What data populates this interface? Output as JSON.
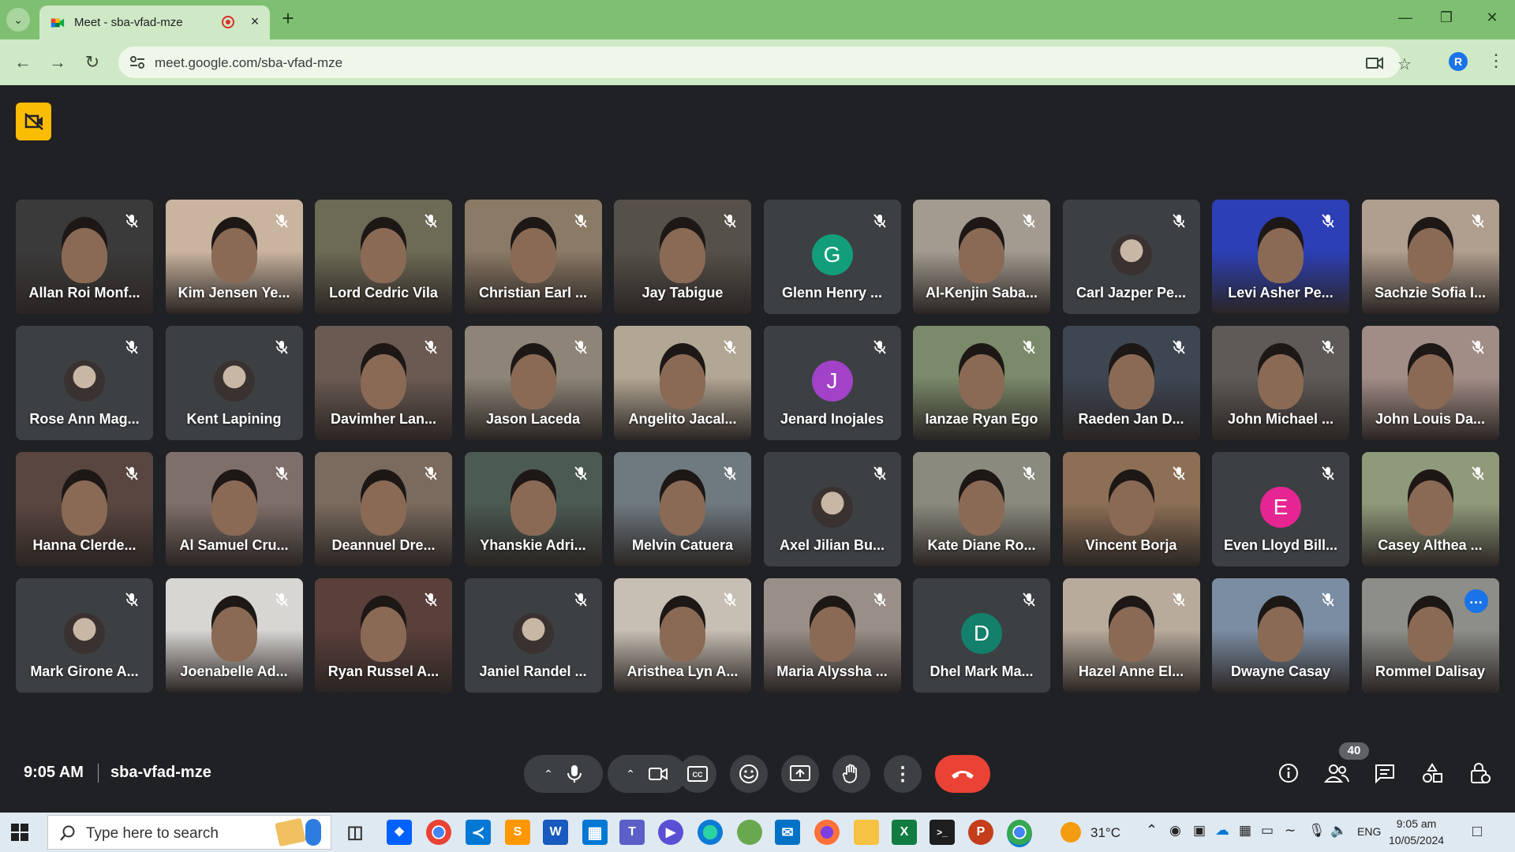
{
  "browser": {
    "tab_title": "Meet - sba-vfad-mze",
    "url": "meet.google.com/sba-vfad-mze",
    "profile_initial": "R",
    "frame_color": "#7fbf72"
  },
  "participants": [
    {
      "name": "Allan Roi Monf...",
      "type": "video",
      "tone": "#3b3a3a"
    },
    {
      "name": "Kim Jensen Ye...",
      "type": "video",
      "tone": "#c9b49f"
    },
    {
      "name": "Lord Cedric Vila",
      "type": "video",
      "tone": "#6d6a55"
    },
    {
      "name": "Christian Earl ...",
      "type": "video",
      "tone": "#8b7a66"
    },
    {
      "name": "Jay Tabigue",
      "type": "video",
      "tone": "#56504a"
    },
    {
      "name": "Glenn Henry ...",
      "type": "initial",
      "initial": "G",
      "color": "#129e7b"
    },
    {
      "name": "Al-Kenjin Saba...",
      "type": "video",
      "tone": "#a39b90"
    },
    {
      "name": "Carl Jazper Pe...",
      "type": "photo"
    },
    {
      "name": "Levi Asher Pe...",
      "type": "video",
      "tone": "#2c3fb5"
    },
    {
      "name": "Sachzie Sofia I...",
      "type": "video",
      "tone": "#b09e8e"
    },
    {
      "name": "Rose Ann Mag...",
      "type": "photo"
    },
    {
      "name": "Kent Lapining",
      "type": "photo"
    },
    {
      "name": "Davimher Lan...",
      "type": "video",
      "tone": "#6a5a52"
    },
    {
      "name": "Jason Laceda",
      "type": "video",
      "tone": "#8e8578"
    },
    {
      "name": "Angelito Jacal...",
      "type": "video",
      "tone": "#b2a694"
    },
    {
      "name": "Jenard Inojales",
      "type": "initial",
      "initial": "J",
      "color": "#a142c8"
    },
    {
      "name": "Ianzae Ryan Ego",
      "type": "video",
      "tone": "#7a8a6a"
    },
    {
      "name": "Raeden Jan D...",
      "type": "video",
      "tone": "#3e4652"
    },
    {
      "name": "John Michael ...",
      "type": "video",
      "tone": "#5e5a57"
    },
    {
      "name": "John Louis Da...",
      "type": "video",
      "tone": "#a28d86"
    },
    {
      "name": "Hanna Clerde...",
      "type": "video",
      "tone": "#5a4640"
    },
    {
      "name": "Al Samuel Cru...",
      "type": "video",
      "tone": "#7f6f6a"
    },
    {
      "name": "Deannuel Dre...",
      "type": "video",
      "tone": "#7a6b5e"
    },
    {
      "name": "Yhanskie Adri...",
      "type": "video",
      "tone": "#4b5a52"
    },
    {
      "name": "Melvin Catuera",
      "type": "video",
      "tone": "#6f7a80"
    },
    {
      "name": "Axel Jilian Bu...",
      "type": "photo"
    },
    {
      "name": "Kate Diane Ro...",
      "type": "video",
      "tone": "#8a8a7e"
    },
    {
      "name": "Vincent Borja",
      "type": "video",
      "tone": "#8c6f55"
    },
    {
      "name": "Even Lloyd Bill...",
      "type": "initial",
      "initial": "E",
      "color": "#e52592"
    },
    {
      "name": "Casey Althea ...",
      "type": "video",
      "tone": "#8f9a7a"
    },
    {
      "name": "Mark Girone A...",
      "type": "photo"
    },
    {
      "name": "Joenabelle Ad...",
      "type": "video",
      "tone": "#d8d6d3"
    },
    {
      "name": "Ryan Russel A...",
      "type": "video",
      "tone": "#5a3f3a"
    },
    {
      "name": "Janiel Randel ...",
      "type": "photo"
    },
    {
      "name": "Aristhea Lyn A...",
      "type": "video",
      "tone": "#c7bfb3"
    },
    {
      "name": "Maria Alyssha ...",
      "type": "video",
      "tone": "#9a8f88"
    },
    {
      "name": "Dhel Mark Ma...",
      "type": "initial",
      "initial": "D",
      "color": "#12806a"
    },
    {
      "name": "Hazel Anne El...",
      "type": "video",
      "tone": "#b8ab9c"
    },
    {
      "name": "Dwayne Casay",
      "type": "video",
      "tone": "#7b8da3"
    },
    {
      "name": "Rommel Dalisay",
      "type": "video",
      "tone": "#8d8e88",
      "active": true
    }
  ],
  "meeting": {
    "time": "9:05 AM",
    "code": "sba-vfad-mze",
    "people_count": "40"
  },
  "taskbar": {
    "search_placeholder": "Type here to search",
    "weather": "31°C",
    "language": "ENG",
    "clock_time": "9:05 am",
    "clock_date": "10/05/2024"
  }
}
